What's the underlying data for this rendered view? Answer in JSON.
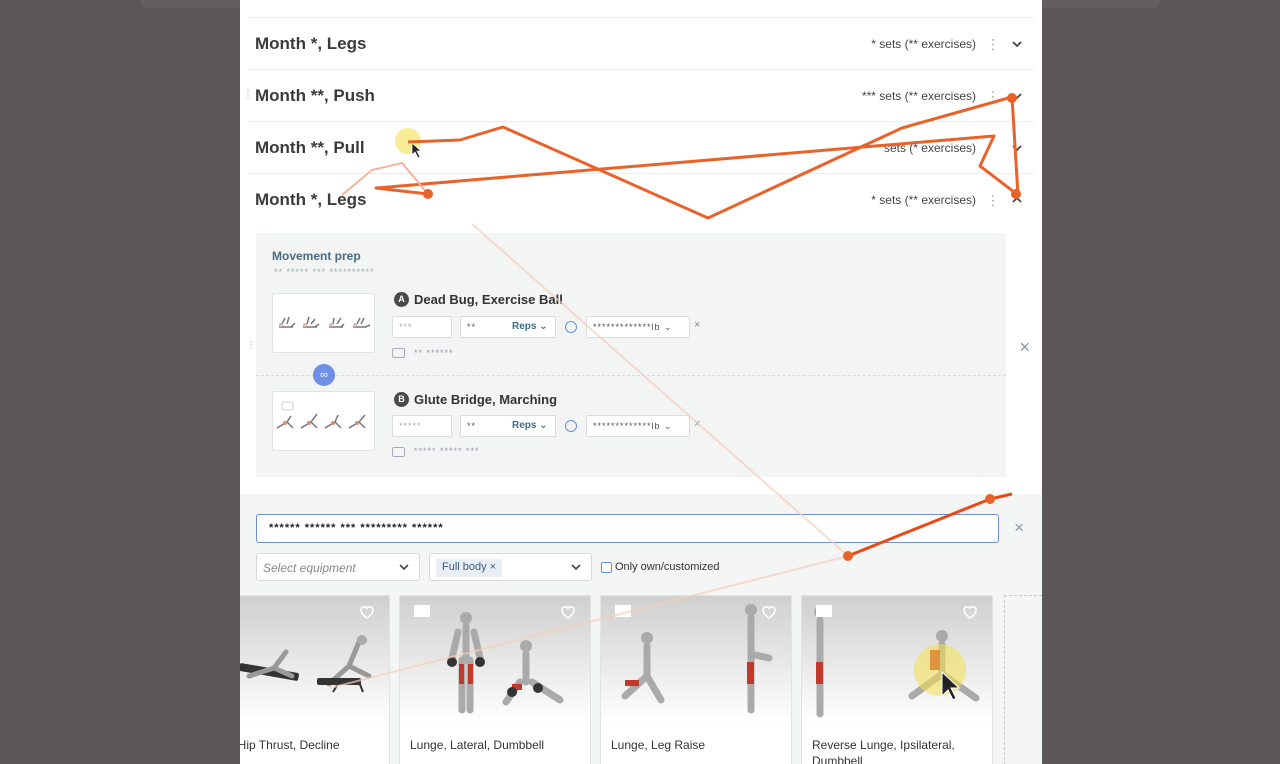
{
  "weeks": [
    {
      "title": "Month *, Legs",
      "meta": "* sets (** exercises)"
    },
    {
      "title": "Month **, Push",
      "meta": "*** sets (** exercises)"
    },
    {
      "title": "Month **, Pull",
      "meta": "sets (* exercises)"
    },
    {
      "title": "Month *, Legs",
      "meta": "* sets (** exercises)"
    }
  ],
  "block": {
    "title": "Movement prep",
    "subtitle": "** ***** *** **********",
    "exercises": [
      {
        "letter": "A",
        "name": "Dead Bug, Exercise Ball",
        "sets": "***",
        "reps_value": "**",
        "reps_unit": "Reps",
        "weight": "*************lb",
        "note": "** ******"
      },
      {
        "letter": "B",
        "name": "Glute Bridge, Marching",
        "sets": "*****",
        "reps_value": "**",
        "reps_unit": "Reps",
        "weight": "*************lb",
        "note": "***** ***** ***"
      }
    ]
  },
  "library": {
    "search_value": "****** ****** *** ********* ******",
    "equipment_placeholder": "Select equipment",
    "muscle_chip": "Full body",
    "own_label": "Only own/customized",
    "cards": [
      {
        "name": "aise, Hip Thrust, Decline"
      },
      {
        "name": "Lunge, Lateral, Dumbbell"
      },
      {
        "name": "Lunge, Leg Raise"
      },
      {
        "name": "Reverse Lunge, Ipsilateral, Dumbbell"
      }
    ]
  },
  "colors": {
    "accent": "#6e8ed8",
    "annotation": "#e8622a",
    "muscle": "#c0392b"
  }
}
